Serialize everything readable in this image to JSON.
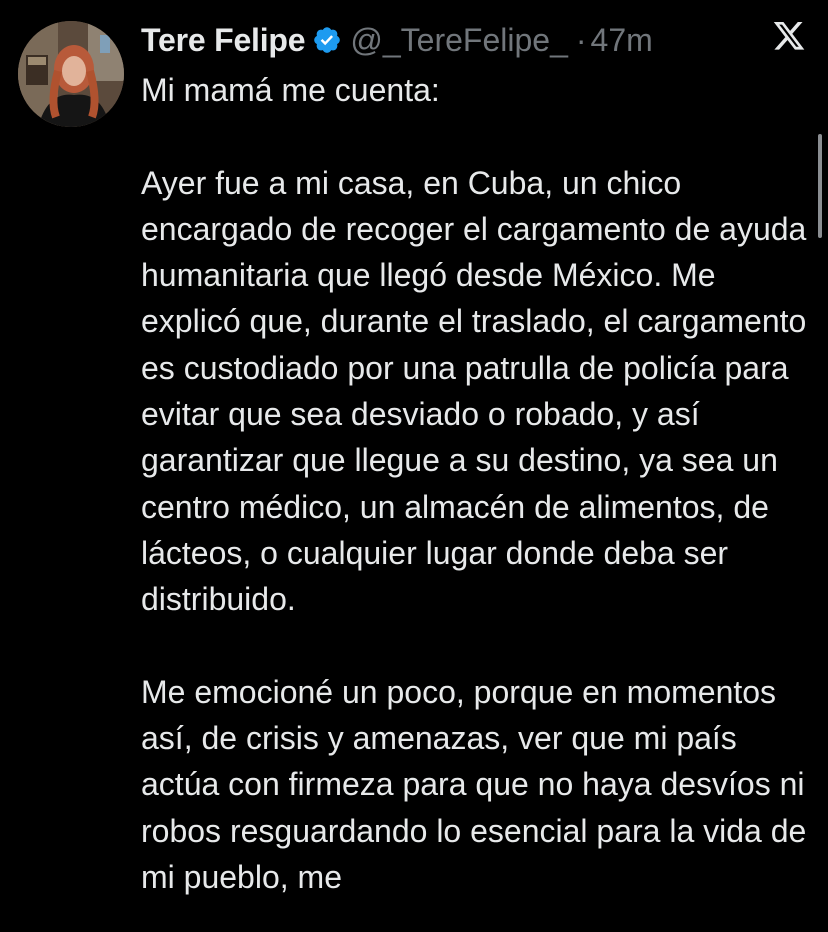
{
  "author": {
    "display_name": "Tere Felipe",
    "handle": "@_TereFelipe_",
    "separator": "·",
    "time": "47m",
    "verified": true,
    "avatar_icon": "profile-photo"
  },
  "platform_logo_icon": "x-logo-icon",
  "tweet": {
    "paragraphs": [
      "Mi mamá me cuenta:",
      "Ayer fue a mi casa, en Cuba, un chico encargado de recoger el cargamento de ayuda humanitaria que llegó desde México. Me explicó que, durante el traslado, el cargamento es custodiado por una patrulla de policía para evitar que sea desviado o robado, y así garantizar que llegue a su destino, ya sea un centro médico, un almacén de alimentos, de lácteos, o cualquier lugar donde deba ser distribuido.",
      "Me emocioné un poco, porque en momentos así, de crisis y amenazas, ver que mi país actúa con firmeza para que no haya desvíos ni robos resguardando lo esencial para la vida de mi pueblo, me"
    ]
  },
  "colors": {
    "background": "#000000",
    "text_primary": "#e7e9ea",
    "text_secondary": "#71767b",
    "verified_badge": "#1d9bf0"
  }
}
